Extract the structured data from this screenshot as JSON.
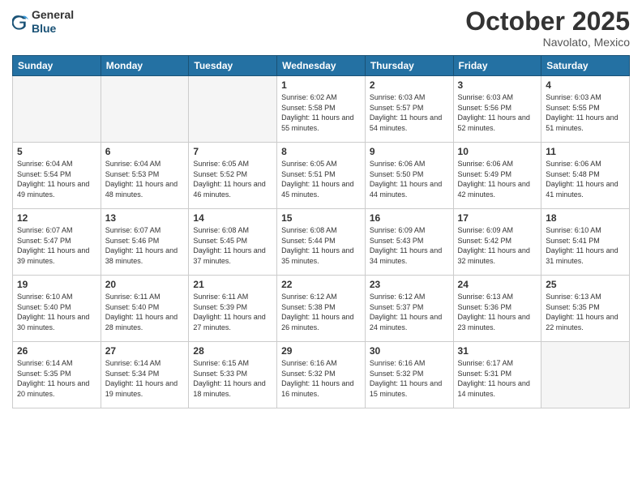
{
  "header": {
    "logo_general": "General",
    "logo_blue": "Blue",
    "month_title": "October 2025",
    "location": "Navolato, Mexico"
  },
  "weekdays": [
    "Sunday",
    "Monday",
    "Tuesday",
    "Wednesday",
    "Thursday",
    "Friday",
    "Saturday"
  ],
  "weeks": [
    [
      {
        "day": "",
        "empty": true
      },
      {
        "day": "",
        "empty": true
      },
      {
        "day": "",
        "empty": true
      },
      {
        "day": "1",
        "sunrise": "6:02 AM",
        "sunset": "5:58 PM",
        "daylight": "11 hours and 55 minutes."
      },
      {
        "day": "2",
        "sunrise": "6:03 AM",
        "sunset": "5:57 PM",
        "daylight": "11 hours and 54 minutes."
      },
      {
        "day": "3",
        "sunrise": "6:03 AM",
        "sunset": "5:56 PM",
        "daylight": "11 hours and 52 minutes."
      },
      {
        "day": "4",
        "sunrise": "6:03 AM",
        "sunset": "5:55 PM",
        "daylight": "11 hours and 51 minutes."
      }
    ],
    [
      {
        "day": "5",
        "sunrise": "6:04 AM",
        "sunset": "5:54 PM",
        "daylight": "11 hours and 49 minutes."
      },
      {
        "day": "6",
        "sunrise": "6:04 AM",
        "sunset": "5:53 PM",
        "daylight": "11 hours and 48 minutes."
      },
      {
        "day": "7",
        "sunrise": "6:05 AM",
        "sunset": "5:52 PM",
        "daylight": "11 hours and 46 minutes."
      },
      {
        "day": "8",
        "sunrise": "6:05 AM",
        "sunset": "5:51 PM",
        "daylight": "11 hours and 45 minutes."
      },
      {
        "day": "9",
        "sunrise": "6:06 AM",
        "sunset": "5:50 PM",
        "daylight": "11 hours and 44 minutes."
      },
      {
        "day": "10",
        "sunrise": "6:06 AM",
        "sunset": "5:49 PM",
        "daylight": "11 hours and 42 minutes."
      },
      {
        "day": "11",
        "sunrise": "6:06 AM",
        "sunset": "5:48 PM",
        "daylight": "11 hours and 41 minutes."
      }
    ],
    [
      {
        "day": "12",
        "sunrise": "6:07 AM",
        "sunset": "5:47 PM",
        "daylight": "11 hours and 39 minutes."
      },
      {
        "day": "13",
        "sunrise": "6:07 AM",
        "sunset": "5:46 PM",
        "daylight": "11 hours and 38 minutes."
      },
      {
        "day": "14",
        "sunrise": "6:08 AM",
        "sunset": "5:45 PM",
        "daylight": "11 hours and 37 minutes."
      },
      {
        "day": "15",
        "sunrise": "6:08 AM",
        "sunset": "5:44 PM",
        "daylight": "11 hours and 35 minutes."
      },
      {
        "day": "16",
        "sunrise": "6:09 AM",
        "sunset": "5:43 PM",
        "daylight": "11 hours and 34 minutes."
      },
      {
        "day": "17",
        "sunrise": "6:09 AM",
        "sunset": "5:42 PM",
        "daylight": "11 hours and 32 minutes."
      },
      {
        "day": "18",
        "sunrise": "6:10 AM",
        "sunset": "5:41 PM",
        "daylight": "11 hours and 31 minutes."
      }
    ],
    [
      {
        "day": "19",
        "sunrise": "6:10 AM",
        "sunset": "5:40 PM",
        "daylight": "11 hours and 30 minutes."
      },
      {
        "day": "20",
        "sunrise": "6:11 AM",
        "sunset": "5:40 PM",
        "daylight": "11 hours and 28 minutes."
      },
      {
        "day": "21",
        "sunrise": "6:11 AM",
        "sunset": "5:39 PM",
        "daylight": "11 hours and 27 minutes."
      },
      {
        "day": "22",
        "sunrise": "6:12 AM",
        "sunset": "5:38 PM",
        "daylight": "11 hours and 26 minutes."
      },
      {
        "day": "23",
        "sunrise": "6:12 AM",
        "sunset": "5:37 PM",
        "daylight": "11 hours and 24 minutes."
      },
      {
        "day": "24",
        "sunrise": "6:13 AM",
        "sunset": "5:36 PM",
        "daylight": "11 hours and 23 minutes."
      },
      {
        "day": "25",
        "sunrise": "6:13 AM",
        "sunset": "5:35 PM",
        "daylight": "11 hours and 22 minutes."
      }
    ],
    [
      {
        "day": "26",
        "sunrise": "6:14 AM",
        "sunset": "5:35 PM",
        "daylight": "11 hours and 20 minutes."
      },
      {
        "day": "27",
        "sunrise": "6:14 AM",
        "sunset": "5:34 PM",
        "daylight": "11 hours and 19 minutes."
      },
      {
        "day": "28",
        "sunrise": "6:15 AM",
        "sunset": "5:33 PM",
        "daylight": "11 hours and 18 minutes."
      },
      {
        "day": "29",
        "sunrise": "6:16 AM",
        "sunset": "5:32 PM",
        "daylight": "11 hours and 16 minutes."
      },
      {
        "day": "30",
        "sunrise": "6:16 AM",
        "sunset": "5:32 PM",
        "daylight": "11 hours and 15 minutes."
      },
      {
        "day": "31",
        "sunrise": "6:17 AM",
        "sunset": "5:31 PM",
        "daylight": "11 hours and 14 minutes."
      },
      {
        "day": "",
        "empty": true
      }
    ]
  ]
}
